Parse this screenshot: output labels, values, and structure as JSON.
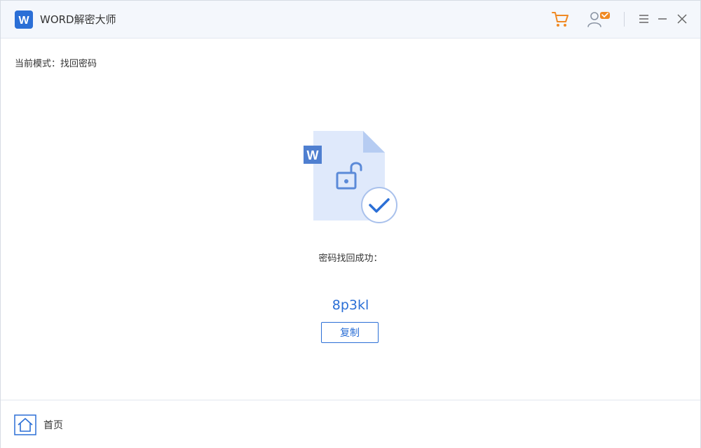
{
  "app": {
    "title": "WORD解密大师",
    "logo_letter": "W",
    "brand_color": "#2b6fd6"
  },
  "titlebar": {
    "icons": [
      "cart-icon",
      "user-icon",
      "menu-icon",
      "minimize-icon",
      "close-icon"
    ],
    "cart_color": "#f08a24"
  },
  "mode": {
    "label": "当前模式：",
    "value": "找回密码"
  },
  "result": {
    "hero_letter": "W",
    "success_text": "密码找回成功：",
    "password": "8p3kl",
    "copy_label": "复制"
  },
  "footer": {
    "home_label": "首页"
  }
}
